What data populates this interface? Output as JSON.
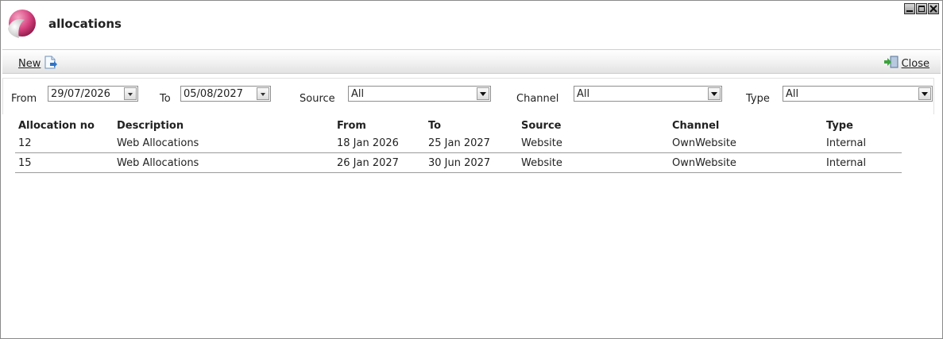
{
  "window": {
    "title": "allocations"
  },
  "toolbar": {
    "new_label": "New",
    "close_label": "Close"
  },
  "filters": {
    "from_label": "From",
    "from_value": "29/07/2026",
    "to_label": "To",
    "to_value": "05/08/2027",
    "source_label": "Source",
    "source_value": "All",
    "channel_label": "Channel",
    "channel_value": "All",
    "type_label": "Type",
    "type_value": "All"
  },
  "table": {
    "headers": [
      "Allocation no",
      "Description",
      "From",
      "To",
      "Source",
      "Channel",
      "Type"
    ],
    "rows": [
      [
        "12",
        "Web Allocations",
        "18 Jan 2026",
        "25 Jan 2027",
        "Website",
        "OwnWebsite",
        "Internal"
      ],
      [
        "15",
        "Web Allocations",
        "26 Jan 2027",
        "30 Jun 2027",
        "Website",
        "OwnWebsite",
        "Internal"
      ]
    ]
  },
  "colors": {
    "accent": "#d6417e",
    "toolbar_bg": "#efefef",
    "border": "#9a9a9a"
  },
  "icons": [
    "app-logo-icon",
    "minimize-icon",
    "maximize-icon",
    "close-window-icon",
    "new-document-icon",
    "exit-door-icon",
    "dropdown-arrow-icon"
  ]
}
